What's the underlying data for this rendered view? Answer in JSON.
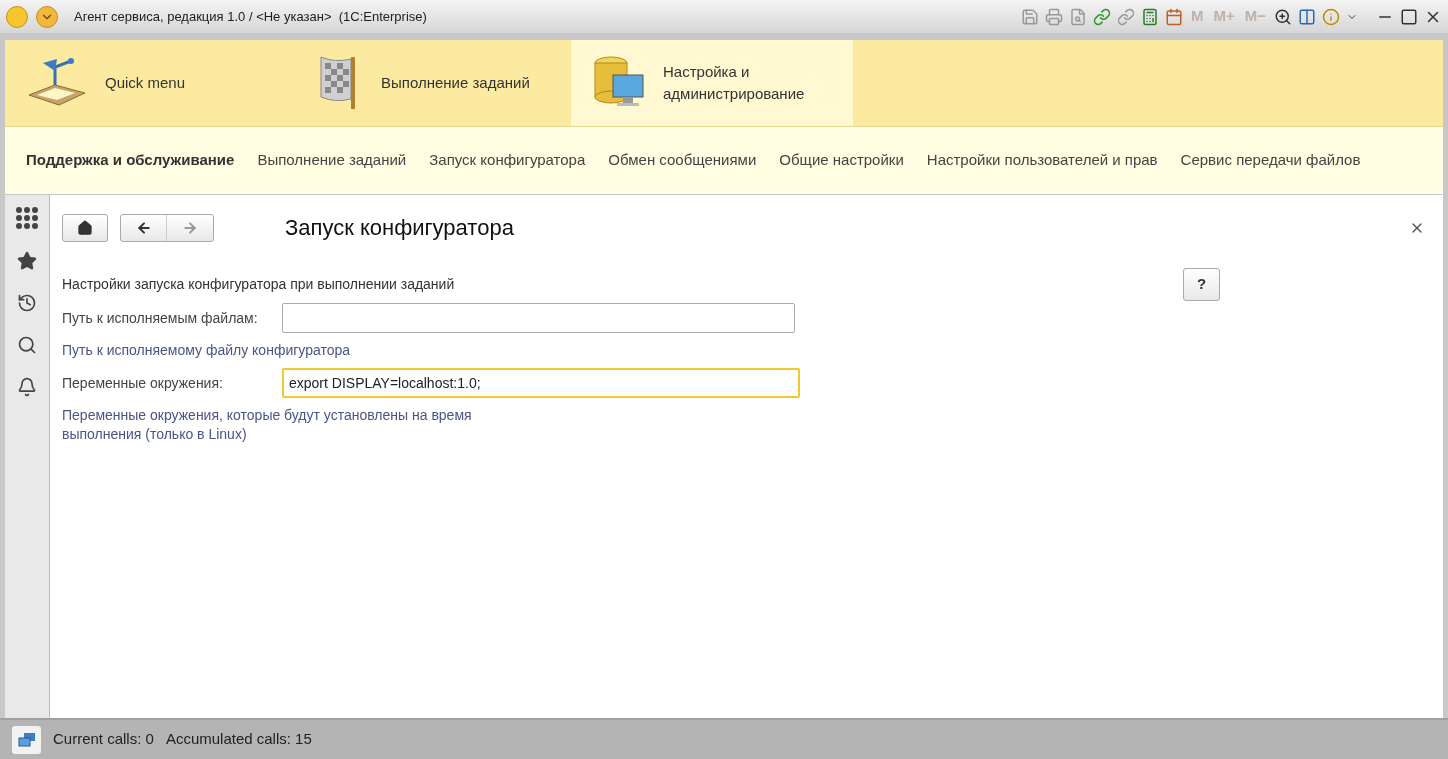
{
  "window": {
    "title": "Агент сервиса, редакция 1.0 / <Не указан>  (1C:Enterprise)",
    "memory_buttons": [
      "M",
      "M+",
      "M−"
    ]
  },
  "sections": [
    {
      "label": "Quick menu",
      "kind": "lamp",
      "selected": false
    },
    {
      "label": "Выполнение заданий",
      "kind": "flag",
      "selected": false
    },
    {
      "label": "Настройка и администрирование",
      "kind": "database",
      "selected": true
    }
  ],
  "subnav": [
    {
      "label": "Поддержка и обслуживание",
      "selected": true
    },
    {
      "label": "Выполнение заданий",
      "selected": false
    },
    {
      "label": "Запуск конфигуратора",
      "selected": false
    },
    {
      "label": "Обмен сообщениями",
      "selected": false
    },
    {
      "label": "Общие настройки",
      "selected": false
    },
    {
      "label": "Настройки пользователей и прав",
      "selected": false
    },
    {
      "label": "Сервис передачи файлов",
      "selected": false
    }
  ],
  "form": {
    "title": "Запуск конфигуратора",
    "help_button": "?",
    "heading": "Настройки запуска конфигуратора при выполнении заданий",
    "fields": [
      {
        "label": "Путь к исполняемым файлам:",
        "focused": false,
        "hint": "Путь к исполняемому файлу конфигуратора"
      },
      {
        "label": "Переменные окружения:",
        "value": "export DISPLAY=localhost:1.0;",
        "focused": true,
        "hint": "Переменные окружения, которые будут установлены на время выполнения (только в Linux)"
      }
    ]
  },
  "status_bar": {
    "current_calls": "Current calls: 0",
    "accumulated_calls": "Accumulated calls: 15"
  }
}
